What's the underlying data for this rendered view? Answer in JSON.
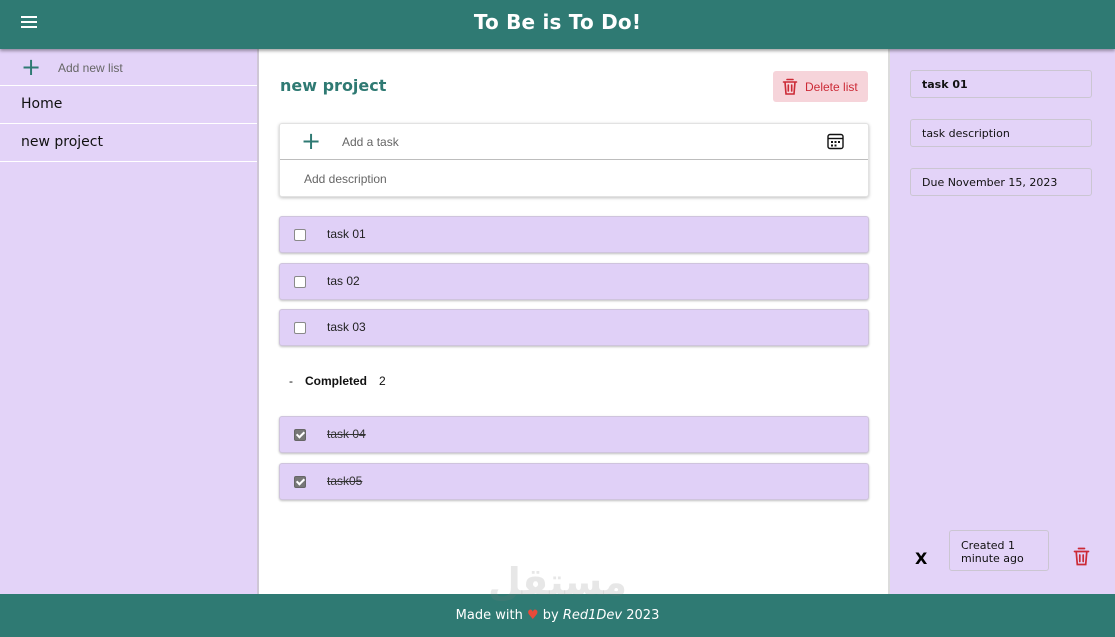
{
  "header": {
    "title": "To Be is To Do!",
    "menu_icon": "hamburger-menu-icon"
  },
  "sidebar": {
    "add_placeholder": "Add new list",
    "items": [
      {
        "label": "Home"
      },
      {
        "label": "new project"
      }
    ]
  },
  "main": {
    "list_title": "new project",
    "delete_label": "Delete list",
    "add_task_placeholder": "Add a task",
    "add_description_placeholder": "Add description",
    "tasks": [
      {
        "name": "task 01",
        "done": false
      },
      {
        "name": "tas 02",
        "done": false
      },
      {
        "name": "task 03",
        "done": false
      }
    ],
    "completed": {
      "toggle": "-",
      "label": "Completed",
      "count": "2"
    },
    "completed_tasks": [
      {
        "name": "task 04",
        "done": true
      },
      {
        "name": "task05",
        "done": true
      }
    ]
  },
  "details": {
    "title": "task 01",
    "description": "task description",
    "due": "Due November 15, 2023",
    "close": "X",
    "created": "Created 1 minute ago"
  },
  "footer": {
    "prefix": "Made with",
    "middle": "by",
    "author": "Red1Dev",
    "year": "2023"
  },
  "watermark": "مستقل",
  "colors": {
    "primary": "#2f7a73",
    "panel": "#e3d3f8",
    "task": "#e0d0f7",
    "danger": "#cc2a36"
  }
}
